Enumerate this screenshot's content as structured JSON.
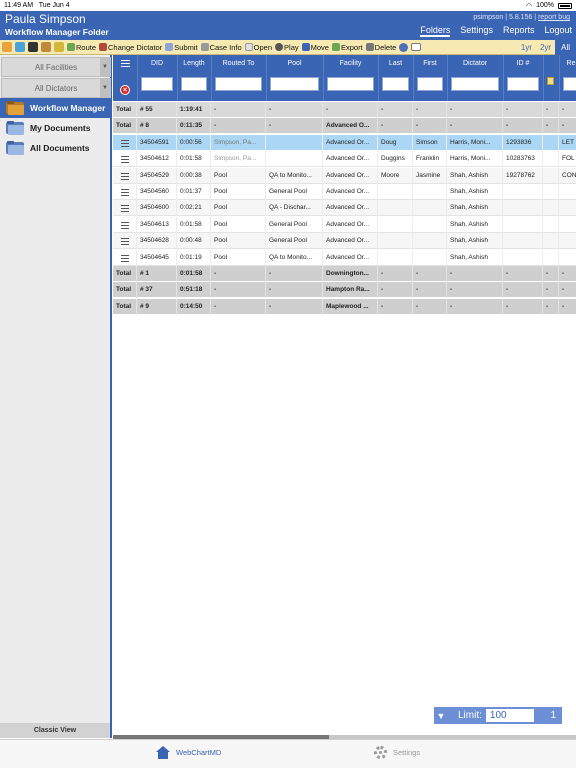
{
  "status_bar": {
    "time": "11:49 AM",
    "date": "Tue Jun 4",
    "battery": "100%"
  },
  "header": {
    "user_name": "Paula Simpson",
    "folder_title": "Workflow Manager Folder",
    "login": "psimpson",
    "version": "5.8.156",
    "report_bug": "report bug",
    "nav": [
      "Folders",
      "Settings",
      "Reports",
      "Logout"
    ]
  },
  "toolbar": {
    "buttons": [
      "Route",
      "Change Dictator",
      "Submit",
      "Case Info",
      "Open",
      "Play",
      "Move",
      "Export",
      "Delete"
    ],
    "ranges": [
      "1yr",
      "2yr",
      "All"
    ],
    "colors": {
      "toolbar_bg": "#f6e9b2",
      "accent": "#3a64b4"
    }
  },
  "sidebar": {
    "filters": [
      "All Facilities",
      "All Dictators"
    ],
    "items": [
      "Workflow Manager",
      "My Documents",
      "All Documents"
    ],
    "classic_view": "Classic View"
  },
  "grid": {
    "columns": [
      "DID",
      "Length",
      "Routed To",
      "Pool",
      "Facility",
      "Last",
      "First",
      "Dictator",
      "ID #",
      "",
      "Re"
    ],
    "rows": [
      {
        "kind": "total",
        "label": "Total",
        "did": "# 55",
        "length": "1:19:41",
        "routed": "-",
        "pool": "-",
        "facility": "-",
        "last": "-",
        "first": "-",
        "dictator": "-",
        "id": "-",
        "x": "-",
        "re": "-"
      },
      {
        "kind": "total",
        "label": "Total",
        "did": "# 8",
        "length": "0:11:35",
        "routed": "-",
        "pool": "-",
        "facility": "Advanced O...",
        "last": "-",
        "first": "-",
        "dictator": "-",
        "id": "-",
        "x": "-",
        "re": "-"
      },
      {
        "kind": "selected",
        "label": "",
        "did": "34504591",
        "length": "0:00:56",
        "routed": "Simpson, Pa...",
        "pool": "",
        "facility": "Advanced Or...",
        "last": "Doug",
        "first": "Simson",
        "dictator": "Harris, Moni...",
        "id": "1293836",
        "x": "",
        "re": "LET"
      },
      {
        "kind": "detail",
        "label": "",
        "did": "34504612",
        "length": "0:01:58",
        "routed": "Simpson, Pa...",
        "pool": "",
        "facility": "Advanced Or...",
        "last": "Duggins",
        "first": "Franklin",
        "dictator": "Harris, Moni...",
        "id": "10283763",
        "x": "",
        "re": "FOL"
      },
      {
        "kind": "detail",
        "label": "",
        "did": "34504529",
        "length": "0:00:38",
        "routed": "Pool",
        "pool": "QA to Monito...",
        "facility": "Advanced Or...",
        "last": "Moore",
        "first": "Jasmine",
        "dictator": "Shah, Ashish",
        "id": "19278762",
        "x": "",
        "re": "CON"
      },
      {
        "kind": "detail",
        "label": "",
        "did": "34504560",
        "length": "0:01:37",
        "routed": "Pool",
        "pool": "General Pool",
        "facility": "Advanced Or...",
        "last": "",
        "first": "",
        "dictator": "Shah, Ashish",
        "id": "",
        "x": "",
        "re": ""
      },
      {
        "kind": "detail",
        "label": "",
        "did": "34504600",
        "length": "0:02:21",
        "routed": "Pool",
        "pool": "QA - Dischar...",
        "facility": "Advanced Or...",
        "last": "",
        "first": "",
        "dictator": "Shah, Ashish",
        "id": "",
        "x": "",
        "re": ""
      },
      {
        "kind": "detail",
        "label": "",
        "did": "34504613",
        "length": "0:01:58",
        "routed": "Pool",
        "pool": "General Pool",
        "facility": "Advanced Or...",
        "last": "",
        "first": "",
        "dictator": "Shah, Ashish",
        "id": "",
        "x": "",
        "re": ""
      },
      {
        "kind": "detail",
        "label": "",
        "did": "34504628",
        "length": "0:00:48",
        "routed": "Pool",
        "pool": "General Pool",
        "facility": "Advanced Or...",
        "last": "",
        "first": "",
        "dictator": "Shah, Ashish",
        "id": "",
        "x": "",
        "re": ""
      },
      {
        "kind": "detail",
        "label": "",
        "did": "34504645",
        "length": "0:01:19",
        "routed": "Pool",
        "pool": "QA to Monito...",
        "facility": "Advanced Or...",
        "last": "",
        "first": "",
        "dictator": "Shah, Ashish",
        "id": "",
        "x": "",
        "re": ""
      },
      {
        "kind": "total",
        "label": "Total",
        "did": "# 1",
        "length": "0:01:58",
        "routed": "-",
        "pool": "-",
        "facility": "Downington...",
        "last": "-",
        "first": "-",
        "dictator": "-",
        "id": "-",
        "x": "-",
        "re": "-"
      },
      {
        "kind": "total",
        "label": "Total",
        "did": "# 37",
        "length": "0:51:18",
        "routed": "-",
        "pool": "-",
        "facility": "Hampton Ra...",
        "last": "-",
        "first": "-",
        "dictator": "-",
        "id": "-",
        "x": "-",
        "re": "-"
      },
      {
        "kind": "total",
        "label": "Total",
        "did": "# 9",
        "length": "0:14:50",
        "routed": "-",
        "pool": "-",
        "facility": "Maplewood ...",
        "last": "-",
        "first": "-",
        "dictator": "-",
        "id": "-",
        "x": "-",
        "re": "-"
      }
    ]
  },
  "limit": {
    "label": "Limit:",
    "value": "100",
    "page": "1"
  },
  "tabbar": {
    "tabs": [
      "WebChartMD",
      "Settings"
    ]
  }
}
